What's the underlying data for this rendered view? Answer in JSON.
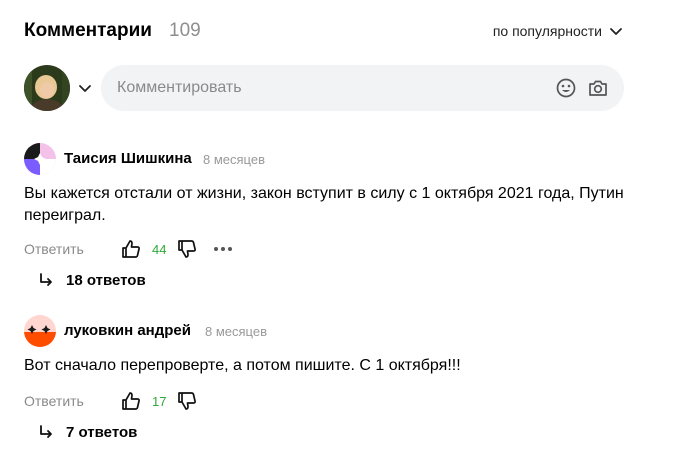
{
  "header": {
    "title": "Комментарии",
    "count": "109",
    "sort_label": "по популярности"
  },
  "composer": {
    "placeholder": "Комментировать"
  },
  "comments": [
    {
      "author": "Таисия Шишкина",
      "time": "8 месяцев",
      "text": "Вы кажется отстали от жизни, закон вступит в силу с 1 октября 2021 года, Путин переиграл.",
      "reply_label": "Ответить",
      "likes": "44",
      "replies": "18 ответов"
    },
    {
      "author": "луковкин андрей",
      "time": "8 месяцев",
      "text": "Вот сначало перепроверте, а потом пишите. С 1 октября!!!",
      "reply_label": "Ответить",
      "likes": "17",
      "replies": "7 ответов"
    }
  ],
  "colors": {
    "like_count": "#2ea936",
    "muted_text": "#8a8a8a",
    "input_bg": "#f2f3f5"
  }
}
